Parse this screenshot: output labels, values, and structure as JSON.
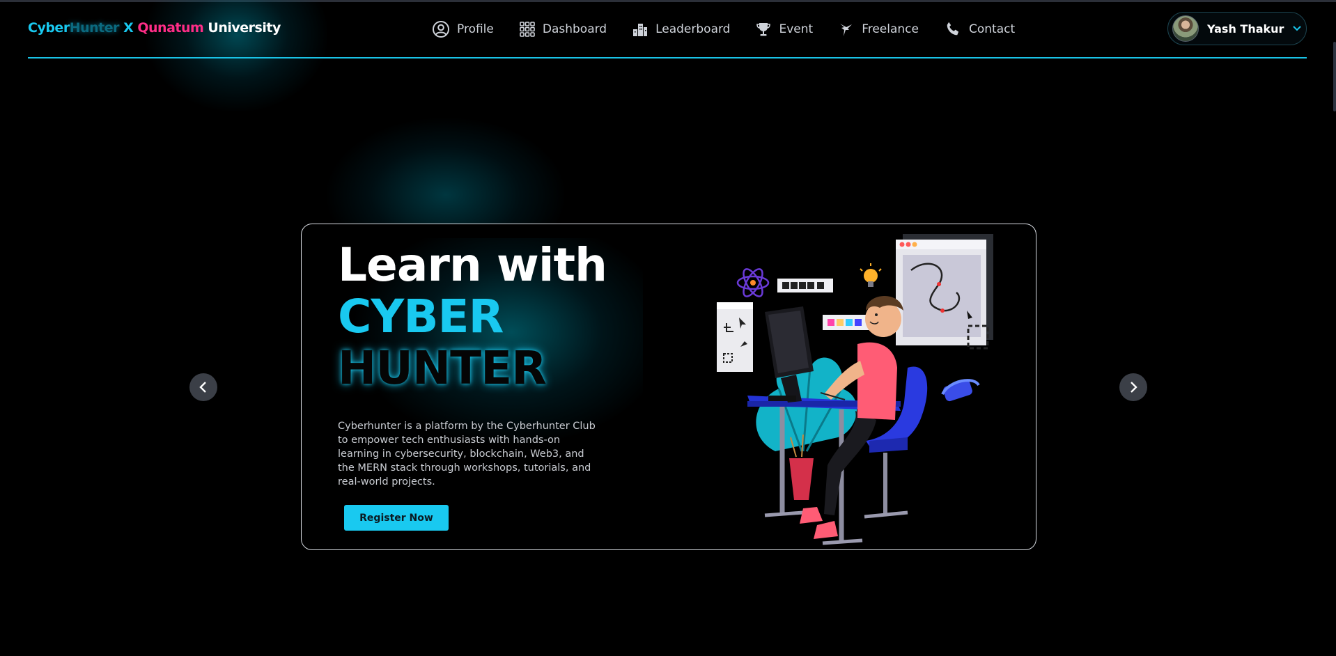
{
  "brand": {
    "part1": "Cyber",
    "part2": "Hunter",
    "part3": " X ",
    "part4": "Qunatum",
    "part5": " University"
  },
  "nav": {
    "items": [
      {
        "label": "Profile",
        "icon": "user-circle-icon"
      },
      {
        "label": "Dashboard",
        "icon": "grid-icon"
      },
      {
        "label": "Leaderboard",
        "icon": "buildings-icon"
      },
      {
        "label": "Event",
        "icon": "trophy-icon"
      },
      {
        "label": "Freelance",
        "icon": "hummingbird-icon"
      },
      {
        "label": "Contact",
        "icon": "phone-icon"
      }
    ]
  },
  "user": {
    "name": "Yash Thakur"
  },
  "hero": {
    "line1": "Learn with",
    "line2": "CYBER",
    "line3": "HUNTER",
    "description": "Cyberhunter is a platform by the Cyberhunter Club to empower tech enthusiasts with hands-on learning in cybersecurity, blockchain, Web3, and the MERN stack through workshops, tutorials, and real-world projects.",
    "cta": "Register Now"
  },
  "colors": {
    "accent": "#19c9f0",
    "brand_pink": "#ff2d87",
    "background": "#000000"
  }
}
